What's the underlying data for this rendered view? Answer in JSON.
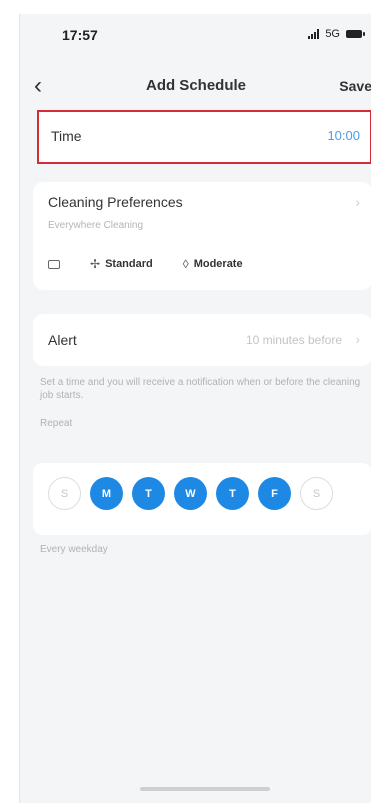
{
  "status_bar": {
    "time": "17:57",
    "network": "5G"
  },
  "nav": {
    "back_icon": "chevron-left-icon",
    "title": "Add Schedule",
    "save_label": "Save"
  },
  "time_row": {
    "label": "Time",
    "value": "10:00"
  },
  "cleaning_preferences": {
    "label": "Cleaning Preferences",
    "subtitle": "Everywhere Cleaning",
    "chips": [
      {
        "icon": "map-icon",
        "label": ""
      },
      {
        "icon": "fan-icon",
        "label": "Standard"
      },
      {
        "icon": "water-drop-icon",
        "label": "Moderate"
      }
    ]
  },
  "alert_row": {
    "label": "Alert",
    "value": "10 minutes before"
  },
  "alert_hint": "Set a time and you will receive a notification when or before the cleaning job starts.",
  "repeat": {
    "label": "Repeat",
    "days": [
      {
        "letter": "S",
        "selected": false
      },
      {
        "letter": "M",
        "selected": true
      },
      {
        "letter": "T",
        "selected": true
      },
      {
        "letter": "W",
        "selected": true
      },
      {
        "letter": "T",
        "selected": true
      },
      {
        "letter": "F",
        "selected": true
      },
      {
        "letter": "S",
        "selected": false
      }
    ],
    "summary": "Every weekday"
  },
  "colors": {
    "accent": "#1e88e5",
    "time_value": "#4b9de8",
    "highlight_border": "#d72c36"
  }
}
